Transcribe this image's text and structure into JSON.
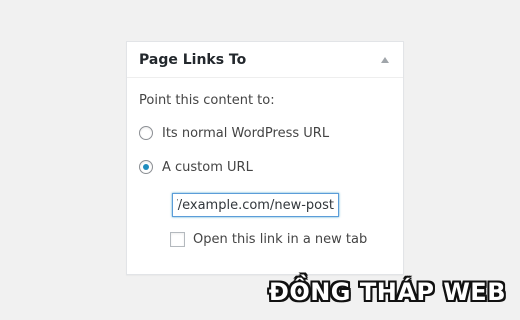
{
  "metabox": {
    "title": "Page Links To",
    "toggle_icon": "triangle-up-icon",
    "prompt": "Point this content to:",
    "options": [
      {
        "label": "Its normal WordPress URL",
        "checked": false
      },
      {
        "label": "A custom URL",
        "checked": true
      }
    ],
    "url_input": {
      "value": "http://example.com/new-post"
    },
    "new_tab": {
      "label": "Open this link in a new tab",
      "checked": false
    }
  },
  "watermark": {
    "text": "ĐỒNG THÁP WEB"
  },
  "colors": {
    "accent": "#1e8cbe",
    "focus_border": "#5b9dd9",
    "background": "#f1f1f1"
  }
}
